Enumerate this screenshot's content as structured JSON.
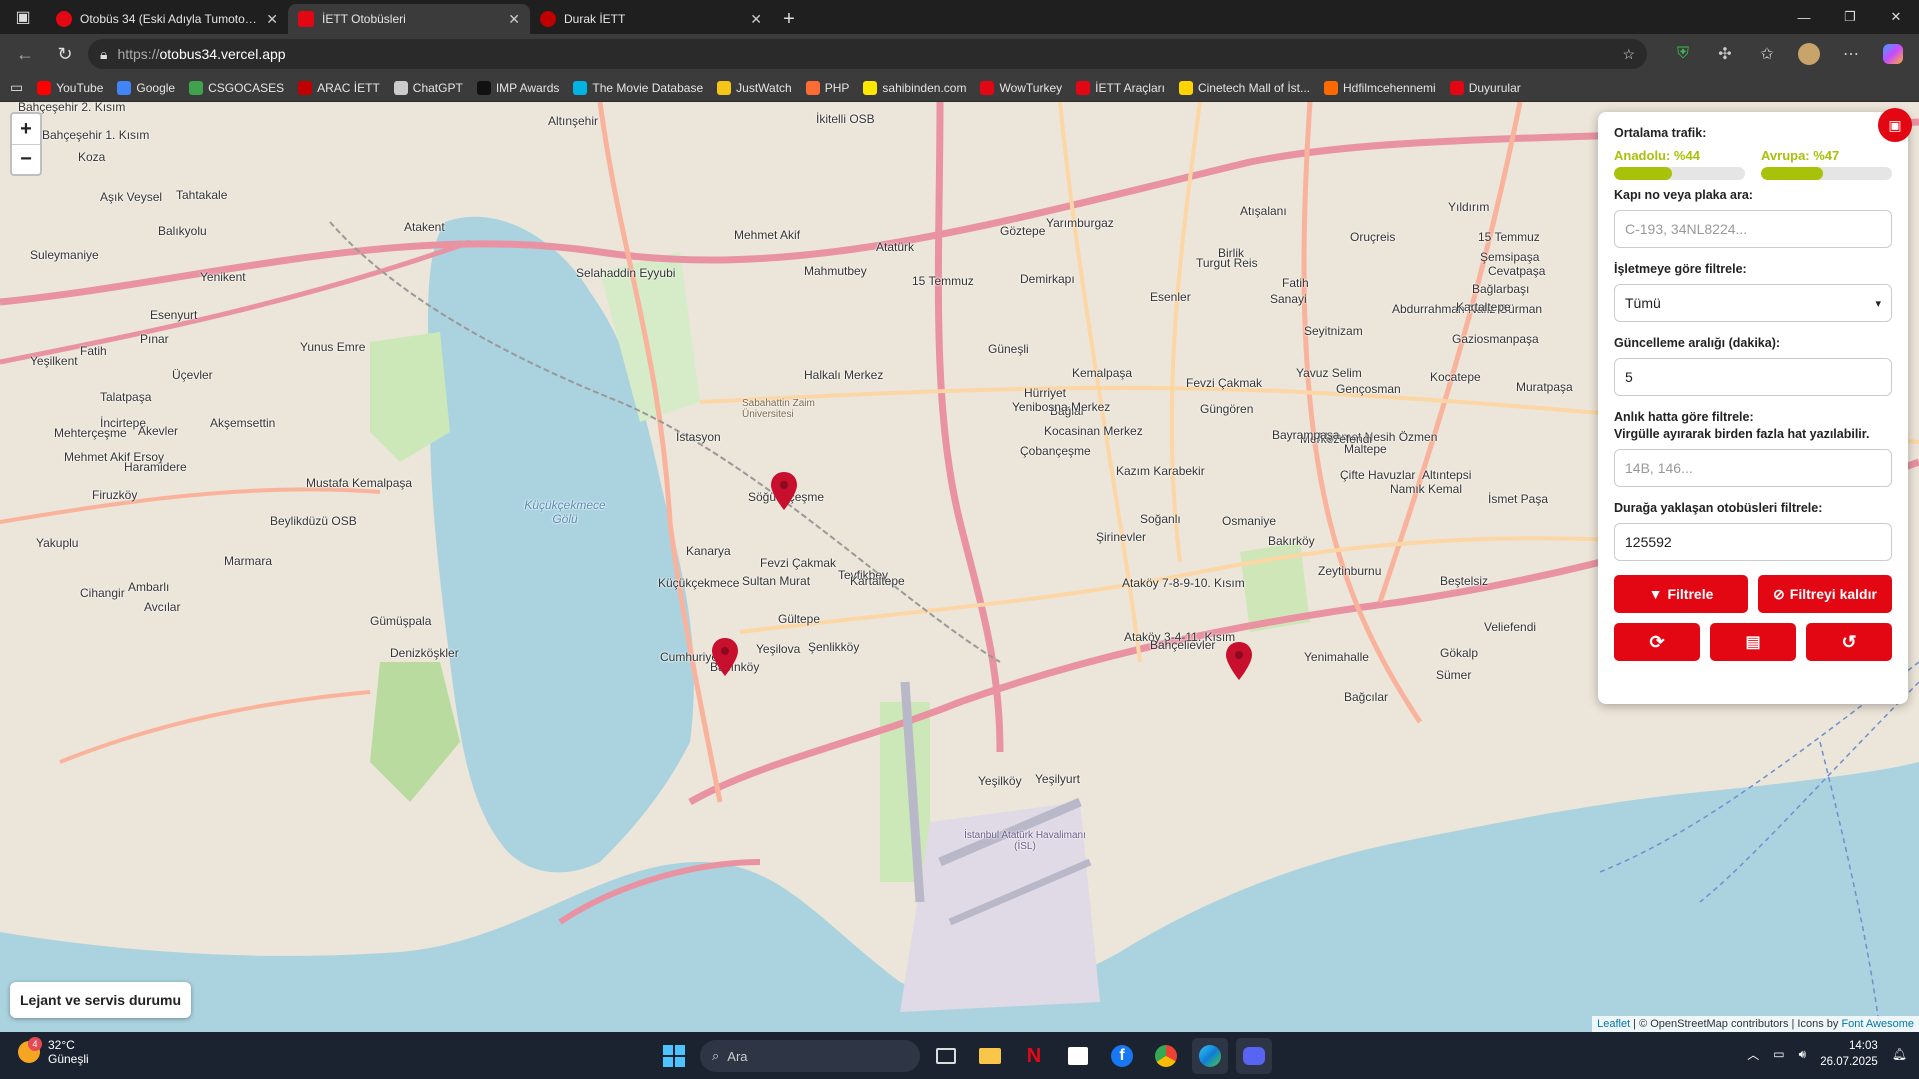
{
  "browser": {
    "tabs": [
      {
        "title": "Otobüs 34 (Eski Adıyla Tumotobüs)",
        "favicon_color": "#e30613"
      },
      {
        "title": "İETT Otobüsleri",
        "favicon_color": "#e30613"
      },
      {
        "title": "Durak İETT",
        "favicon_color": "#c00000"
      }
    ],
    "url_prefix": "https://",
    "url_host": "otobus34.vercel.app",
    "bookmarks": [
      {
        "label": "YouTube",
        "color": "#ff0000"
      },
      {
        "label": "Google",
        "color": "#4285f4"
      },
      {
        "label": "CSGOCASES",
        "color": "#3fa34d"
      },
      {
        "label": "ARAC İETT",
        "color": "#c00000"
      },
      {
        "label": "ChatGPT",
        "color": "#cccccc"
      },
      {
        "label": "IMP Awards",
        "color": "#111111"
      },
      {
        "label": "The Movie Database",
        "color": "#01b4e4"
      },
      {
        "label": "JustWatch",
        "color": "#f5c518"
      },
      {
        "label": "PHP",
        "color": "#ff6b35"
      },
      {
        "label": "sahibinden.com",
        "color": "#ffe800"
      },
      {
        "label": "WowTurkey",
        "color": "#e30613"
      },
      {
        "label": "İETT Araçları",
        "color": "#e30613"
      },
      {
        "label": "Cinetech Mall of İst...",
        "color": "#ffd400"
      },
      {
        "label": "Hdfilmcehennemi",
        "color": "#ff6a00"
      },
      {
        "label": "Duyurular",
        "color": "#e30613"
      }
    ]
  },
  "map": {
    "zoom_in": "+",
    "zoom_out": "−",
    "legend": "Lejant ve servis durumu",
    "attribution_leaflet": "Leaflet",
    "attribution_rest": " | © OpenStreetMap contributors | Icons by ",
    "attribution_fa": "Font Awesome",
    "lake_name": "Küçükçekmece Gölü",
    "places": [
      "Altınşehir",
      "İkitelli OSB",
      "Bahçeşehir 2. Kısım",
      "Bahçeşehir 1. Kısım",
      "Koza",
      "Aşık Veysel",
      "Tahtakale",
      "Atakent",
      "Mehmet Akif",
      "Atatürk",
      "Mahmutbey",
      "Göztepe",
      "Demirkapı",
      "Yarımburgaz",
      "Selahaddin Eyyubi",
      "Suleymaniye",
      "Balıkyolu",
      "Yenikent",
      "Esenyurt",
      "Pınar",
      "Fatih",
      "Yeşilkent",
      "Yunus Emre",
      "Üçevler",
      "Talatpaşa",
      "İncirtepe",
      "Akşemsettin",
      "Mehterçeşme",
      "Akevler",
      "Mehmet Akif Ersoy",
      "Haramidere",
      "Firuzköy",
      "Mustafa Kemalpaşa",
      "Beylikdüzü OSB",
      "Yakuplu",
      "Cihangir",
      "Marmara",
      "Avcılar",
      "Gümüşpala",
      "Denizköşkler",
      "Ambarlı",
      "Halkalı Merkez",
      "İstasyon",
      "Söğütlüçeşme",
      "Kanarya",
      "Tevfikbey",
      "Fevzi Çakmak",
      "Sultan Murat",
      "Kartaltepe",
      "Cumhuriyet",
      "Küçükçekmece",
      "Gültepe",
      "Yeşilova",
      "Basınköy",
      "Şenlikköy",
      "Yeşilköy",
      "Yeşilyurt",
      "15 Temmuz",
      "Güneşli",
      "Hürriyet",
      "Bağlar",
      "Kocasinan Merkez",
      "Yenibosna Merkez",
      "Çobançeşme",
      "Soğanlı",
      "Şirinevler",
      "Ataköy 7-8-9-10. Kısım",
      "Ataköy 3-4-11. Kısım",
      "Bahçelievler",
      "Osmaniye",
      "Bakırköy",
      "Zeytinburnu",
      "Yenimahalle",
      "Bağcılar",
      "Kemalpaşa",
      "Fevzi Çakmak",
      "Kazım Karabekir",
      "Esenler",
      "Yavuz Selim",
      "Gençosman",
      "Güngören",
      "Sanayi",
      "Mehmet Nesih Özmen",
      "Abdurrahman Nafiz Gürman",
      "Merkezefendi",
      "Maltepe",
      "Bayrampaşa",
      "Çifte Havuzlar",
      "Namık Kemal",
      "Altıntepsi",
      "İsmet Paşa",
      "Muratpaşa",
      "Kocatepe",
      "Kartaltepe",
      "Gaziosmanpaşa",
      "Bağlarbaşı",
      "Şemsipaşa",
      "Cevatpaşa",
      "Yıldırım",
      "15 Temmuz",
      "Oruçreis",
      "Turgut Reis",
      "Atışalanı",
      "Birlik",
      "Fatih",
      "Seyitnizam",
      "Beştelsiz",
      "Veliefendi",
      "Gökalp",
      "Sümer"
    ],
    "airport": "İstanbul Atatürk Havalimanı (İSL)",
    "school": "Sabahattin Zaim Üniversitesi"
  },
  "panel": {
    "traffic_title": "Ortalama trafik:",
    "anadolu_label": "Anadolu: %44",
    "anadolu_value": 44,
    "avrupa_label": "Avrupa: %47",
    "avrupa_value": 47,
    "traffic_color": "#a8c20a",
    "search_label": "Kapı no veya plaka ara:",
    "search_placeholder": "C-193, 34NL8224...",
    "operator_label": "İşletmeye göre filtrele:",
    "operator_value": "Tümü",
    "interval_label": "Güncelleme aralığı (dakika):",
    "interval_value": "5",
    "line_label": "Anlık hatta göre filtrele:",
    "line_hint": "Virgülle ayırarak birden fazla hat yazılabilir.",
    "line_placeholder": "14B, 146...",
    "stop_label": "Durağa yaklaşan otobüsleri filtrele:",
    "stop_value": "125592",
    "filter_btn": "Filtrele",
    "clear_btn": "Filtreyi kaldır",
    "accent": "#e30613"
  },
  "taskbar": {
    "temp": "32°C",
    "condition": "Güneşli",
    "notif": "4",
    "search": "Ara",
    "time": "14:03",
    "date": "26.07.2025"
  }
}
